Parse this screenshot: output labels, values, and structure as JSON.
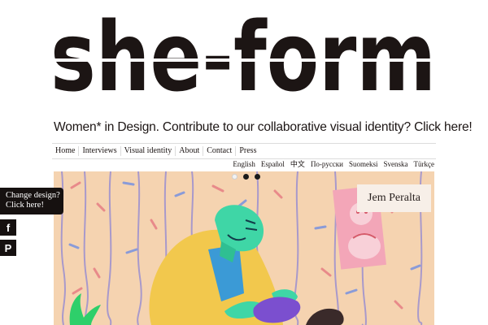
{
  "brand": {
    "logo_text": "she-form",
    "logo_color": "#1c1514"
  },
  "tagline": {
    "text": "Women* in Design. Contribute to our collaborative visual identity? Click here!"
  },
  "nav": {
    "items": [
      "Home",
      "Interviews",
      "Visual identity",
      "About",
      "Contact",
      "Press"
    ]
  },
  "languages": [
    "English",
    "Español",
    "中文",
    "По-русски",
    "Suomeksi",
    "Svenska",
    "Türkçe"
  ],
  "hero": {
    "artist_name": "Jem Peralta",
    "slide_count": 3,
    "active_slide": 1,
    "background_color": "#f5d3b0"
  },
  "sidebar": {
    "change_design_line1": "Change design?",
    "change_design_line2": "Click here!",
    "facebook_glyph": "f",
    "pinterest_glyph": "P"
  }
}
